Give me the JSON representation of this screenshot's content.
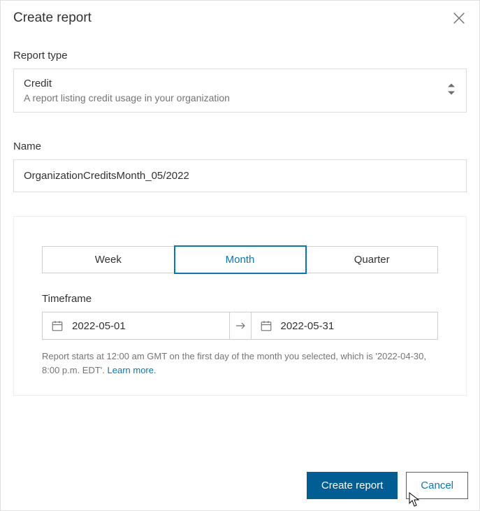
{
  "header": {
    "title": "Create report"
  },
  "reportType": {
    "label": "Report type",
    "value": "Credit",
    "description": "A report listing credit usage in your organization"
  },
  "nameField": {
    "label": "Name",
    "value": "OrganizationCreditsMonth_05/2022"
  },
  "period": {
    "options": [
      "Week",
      "Month",
      "Quarter"
    ],
    "selected": "Month"
  },
  "timeframe": {
    "label": "Timeframe",
    "start": "2022-05-01",
    "end": "2022-05-31",
    "hint_prefix": "Report starts at 12:00 am GMT on the first day of the month you selected, which is '2022-04-30, 8:00 p.m. EDT'. ",
    "learn_more": "Learn more."
  },
  "footer": {
    "primary": "Create report",
    "secondary": "Cancel"
  }
}
